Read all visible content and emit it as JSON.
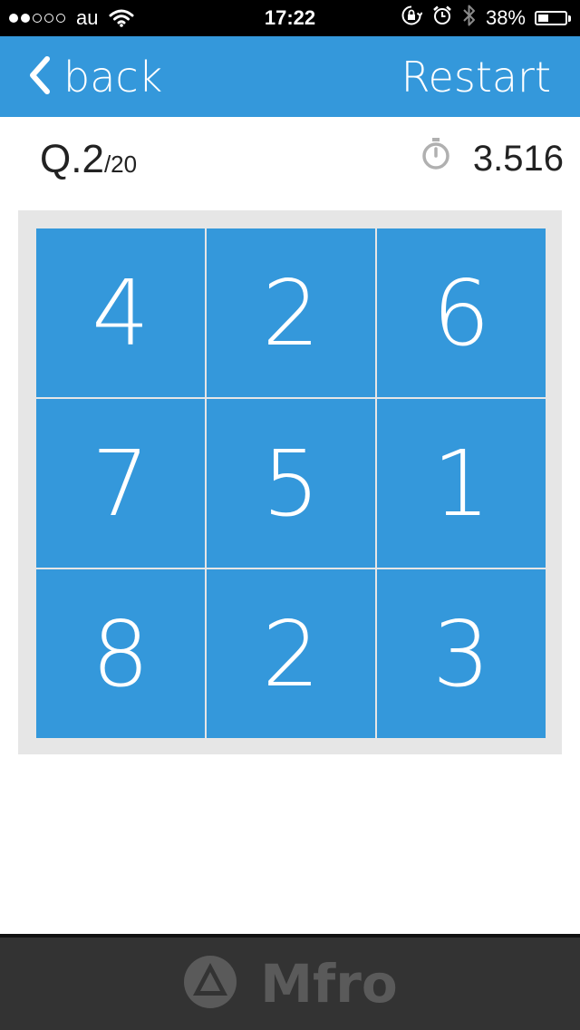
{
  "status_bar": {
    "signal_dots_filled": 2,
    "signal_dots_total": 5,
    "carrier": "au",
    "time": "17:22",
    "battery_percent": "38%",
    "battery_level": 0.38,
    "icons": [
      "wifi-icon",
      "rotation-lock-icon",
      "alarm-icon",
      "bluetooth-icon",
      "battery-icon"
    ]
  },
  "nav": {
    "back_label": "back",
    "restart_label": "Restart",
    "color": "#3498db"
  },
  "info": {
    "question_prefix": "Q.",
    "question_number": "2",
    "question_total": "/20",
    "timer_value": "3.516",
    "timer_icon": "stopwatch-icon"
  },
  "grid": {
    "cells": [
      "4",
      "2",
      "6",
      "7",
      "5",
      "1",
      "8",
      "2",
      "3"
    ]
  },
  "footer": {
    "brand": "Mfro",
    "logo_icon": "mfro-logo-icon"
  }
}
